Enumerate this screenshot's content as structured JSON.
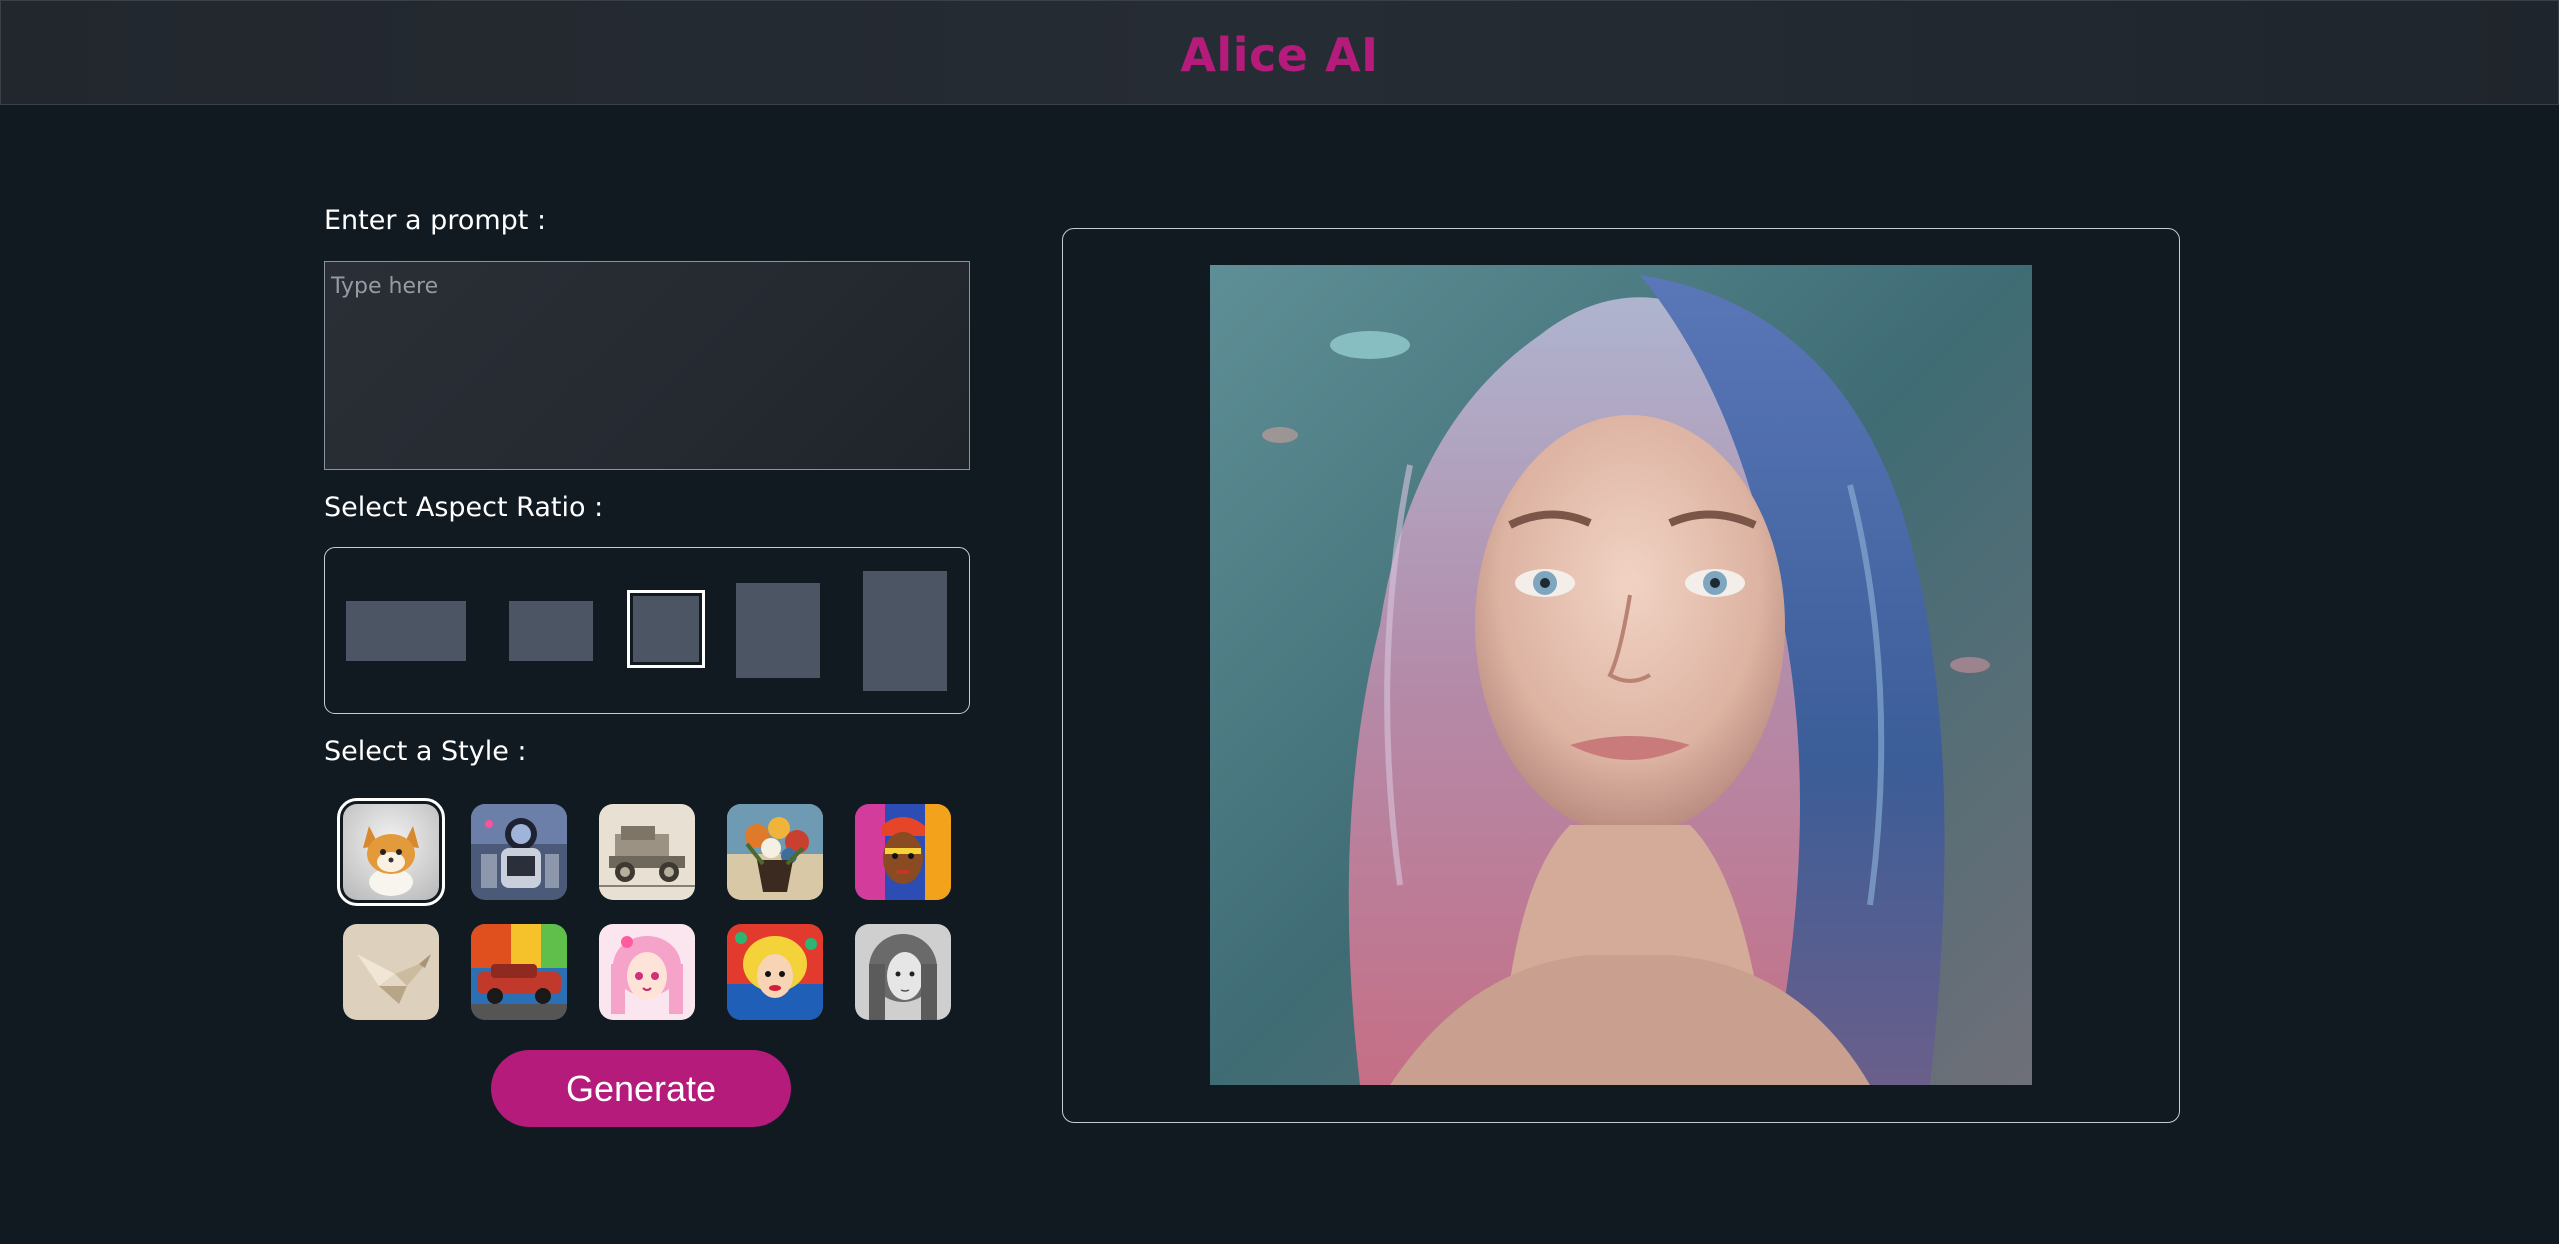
{
  "header": {
    "title": "Alice AI"
  },
  "prompt": {
    "label": "Enter a prompt :",
    "placeholder": "Type here",
    "value": ""
  },
  "aspect_ratio": {
    "label": "Select Aspect Ratio :",
    "options": [
      "16:9",
      "3:2",
      "1:1",
      "4:5",
      "2:3"
    ],
    "selected": "1:1"
  },
  "style": {
    "label": "Select a Style :",
    "options": [
      "cute-animal-3d",
      "sci-fi-robot",
      "vintage-sketch",
      "flower-painting",
      "tribal-portrait",
      "origami",
      "graffiti-car",
      "anime-pink",
      "pop-art",
      "pencil-sketch"
    ],
    "selected_index": 0
  },
  "generate_button": {
    "label": "Generate"
  },
  "colors": {
    "accent": "#b41b7b",
    "background": "#111a21",
    "ratio_fill": "#4b5563"
  }
}
